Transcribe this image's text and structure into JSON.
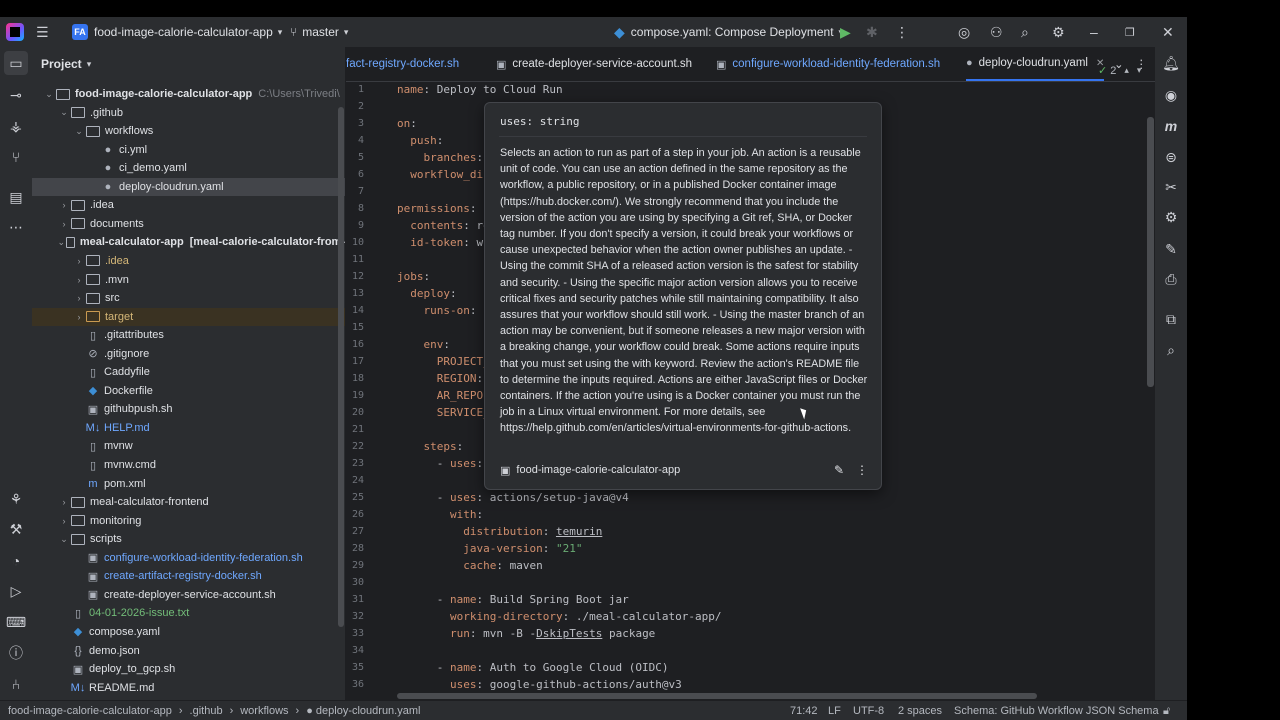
{
  "titlebar": {
    "project_initials": "FA",
    "project_name": "food-image-calorie-calculator-app",
    "branch": "master",
    "run_config": "compose.yaml: Compose Deployment"
  },
  "project_panel": {
    "title": "Project",
    "tree": [
      {
        "label": "food-image-calorie-calculator-app",
        "hint": "C:\\Users\\Trivedi\\",
        "type": "module",
        "indent": 0,
        "open": true
      },
      {
        "label": ".github",
        "type": "folder",
        "indent": 1,
        "open": true
      },
      {
        "label": "workflows",
        "type": "folder",
        "indent": 2,
        "open": true
      },
      {
        "label": "ci.yml",
        "type": "github",
        "indent": 3
      },
      {
        "label": "ci_demo.yaml",
        "type": "github",
        "indent": 3
      },
      {
        "label": "deploy-cloudrun.yaml",
        "type": "github",
        "indent": 3,
        "selected": true
      },
      {
        "label": ".idea",
        "type": "folder",
        "indent": 1,
        "collapsed": true
      },
      {
        "label": "documents",
        "type": "folder",
        "indent": 1,
        "collapsed": true
      },
      {
        "label": "meal-calculator-app",
        "hint": "[meal-calorie-calculator-from-",
        "type": "module",
        "indent": 1,
        "open": true
      },
      {
        "label": ".idea",
        "type": "folder",
        "indent": 2,
        "collapsed": true,
        "color": "#d5b778"
      },
      {
        "label": ".mvn",
        "type": "folder",
        "indent": 2,
        "collapsed": true
      },
      {
        "label": "src",
        "type": "folder",
        "indent": 2,
        "collapsed": true
      },
      {
        "label": "target",
        "type": "folder-orange",
        "indent": 2,
        "collapsed": true,
        "color": "#d5b778",
        "excluded": true
      },
      {
        "label": ".gitattributes",
        "type": "file",
        "indent": 2
      },
      {
        "label": ".gitignore",
        "type": "ignore",
        "indent": 2
      },
      {
        "label": "Caddyfile",
        "type": "file",
        "indent": 2
      },
      {
        "label": "Dockerfile",
        "type": "docker",
        "indent": 2
      },
      {
        "label": "githubpush.sh",
        "type": "shell",
        "indent": 2
      },
      {
        "label": "HELP.md",
        "type": "md",
        "indent": 2,
        "color": "#6fa8ff"
      },
      {
        "label": "mvnw",
        "type": "file",
        "indent": 2
      },
      {
        "label": "mvnw.cmd",
        "type": "file",
        "indent": 2
      },
      {
        "label": "pom.xml",
        "type": "maven",
        "indent": 2
      },
      {
        "label": "meal-calculator-frontend",
        "type": "folder",
        "indent": 1,
        "collapsed": true
      },
      {
        "label": "monitoring",
        "type": "folder",
        "indent": 1,
        "collapsed": true
      },
      {
        "label": "scripts",
        "type": "folder",
        "indent": 1,
        "open": true
      },
      {
        "label": "configure-workload-identity-federation.sh",
        "type": "shell",
        "indent": 2,
        "color": "#6fa8ff"
      },
      {
        "label": "create-artifact-registry-docker.sh",
        "type": "shell",
        "indent": 2,
        "color": "#6fa8ff"
      },
      {
        "label": "create-deployer-service-account.sh",
        "type": "shell",
        "indent": 2
      },
      {
        "label": "04-01-2026-issue.txt",
        "type": "file",
        "indent": 1,
        "color": "#73bd79"
      },
      {
        "label": "compose.yaml",
        "type": "docker",
        "indent": 1
      },
      {
        "label": "demo.json",
        "type": "json",
        "indent": 1
      },
      {
        "label": "deploy_to_gcp.sh",
        "type": "shell",
        "indent": 1
      },
      {
        "label": "README.md",
        "type": "md",
        "indent": 1
      }
    ]
  },
  "tabs": [
    {
      "label": "fact-registry-docker.sh",
      "color": "#6fa8ff"
    },
    {
      "label": "create-deployer-service-account.sh",
      "color": "#dfe1e5"
    },
    {
      "label": "configure-workload-identity-federation.sh",
      "color": "#6fa8ff"
    },
    {
      "label": "deploy-cloudrun.yaml",
      "color": "#dfe1e5",
      "active": true
    }
  ],
  "inspection_count": "2",
  "code_lines": [
    {
      "n": "1",
      "html": "<span class='k'>name</span>: Deploy to Cloud Run"
    },
    {
      "n": "2",
      "html": ""
    },
    {
      "n": "3",
      "html": "<span class='k'>on</span>:"
    },
    {
      "n": "4",
      "html": "  <span class='k'>push</span>:"
    },
    {
      "n": "5",
      "html": "    <span class='k'>branches</span>:"
    },
    {
      "n": "6",
      "html": "  <span class='k'>workflow_dis</span>"
    },
    {
      "n": "7",
      "html": ""
    },
    {
      "n": "8",
      "html": "<span class='k'>permissions</span>:"
    },
    {
      "n": "9",
      "html": "  <span class='k'>contents</span>: re"
    },
    {
      "n": "10",
      "html": "  <span class='k'>id-token</span>: wr"
    },
    {
      "n": "11",
      "html": ""
    },
    {
      "n": "12",
      "html": "<span class='k'>jobs</span>:"
    },
    {
      "n": "13",
      "html": "  <span class='k'>deploy</span>:"
    },
    {
      "n": "14",
      "html": "    <span class='k'>runs-on</span>: u"
    },
    {
      "n": "15",
      "html": ""
    },
    {
      "n": "16",
      "html": "    <span class='k'>env</span>:"
    },
    {
      "n": "17",
      "html": "      <span class='k'>PROJECT_</span>"
    },
    {
      "n": "18",
      "html": "      <span class='k'>REGION</span>:"
    },
    {
      "n": "19",
      "html": "      <span class='k'>AR_REPO</span>:"
    },
    {
      "n": "20",
      "html": "      <span class='k'>SERVICE_</span>"
    },
    {
      "n": "21",
      "html": ""
    },
    {
      "n": "22",
      "html": "    <span class='k'>steps</span>:"
    },
    {
      "n": "23",
      "html": "      - <span class='k'>uses</span>:"
    },
    {
      "n": "24",
      "html": ""
    },
    {
      "n": "25",
      "html": "      - <span class='k'>uses</span>: actions/setup-java@v4"
    },
    {
      "n": "26",
      "html": "        <span class='k'>with</span>:"
    },
    {
      "n": "27",
      "html": "          <span class='k'>distribution</span>: <span class='u'>temurin</span>"
    },
    {
      "n": "28",
      "html": "          <span class='k'>java-version</span>: <span class='s'>\"21\"</span>"
    },
    {
      "n": "29",
      "html": "          <span class='k'>cache</span>: maven"
    },
    {
      "n": "30",
      "html": ""
    },
    {
      "n": "31",
      "html": "      - <span class='k'>name</span>: Build Spring Boot jar"
    },
    {
      "n": "32",
      "html": "        <span class='k'>working-directory</span>: ./meal-calculator-app/"
    },
    {
      "n": "33",
      "html": "        <span class='k'>run</span>: mvn -B -<span class='u'>DskipTests</span> package"
    },
    {
      "n": "34",
      "html": ""
    },
    {
      "n": "35",
      "html": "      - <span class='k'>name</span>: Auth to Google Cloud (OIDC)"
    },
    {
      "n": "36",
      "html": "        <span class='k'>uses</span>: google-github-actions/auth@v3"
    }
  ],
  "popup": {
    "header": "uses: string",
    "body": "Selects an action to run as part of a step in your job. An action is a reusable unit of code. You can use an action defined in the same repository as the workflow, a public repository, or in a published Docker container image (https://hub.docker.com/). We strongly recommend that you include the version of the action you are using by specifying a Git ref, SHA, or Docker tag number. If you don't specify a version, it could break your workflows or cause unexpected behavior when the action owner publishes an update. - Using the commit SHA of a released action version is the safest for stability and security. - Using the specific major action version allows you to receive critical fixes and security patches while still maintaining compatibility. It also assures that your workflow should still work. - Using the master branch of an action may be convenient, but if someone releases a new major version with a breaking change, your workflow could break. Some actions require inputs that you must set using the with keyword. Review the action's README file to determine the inputs required. Actions are either JavaScript files or Docker containers. If the action you're using is a Docker container you must run the job in a Linux virtual environment. For more details, see https://help.github.com/en/articles/virtual-environments-for-github-actions.",
    "footer": "food-image-calorie-calculator-app"
  },
  "statusbar": {
    "crumbs": [
      "food-image-calorie-calculator-app",
      ".github",
      "workflows",
      "deploy-cloudrun.yaml"
    ],
    "position": "71:42",
    "line_sep": "LF",
    "encoding": "UTF-8",
    "indent": "2 spaces",
    "schema": "Schema: GitHub Workflow JSON Schema"
  },
  "colors": {
    "accent": "#3574f0",
    "bg": "#1e1f22",
    "panel": "#2b2d30",
    "keyword": "#cf8e6d",
    "string": "#6aab73"
  }
}
